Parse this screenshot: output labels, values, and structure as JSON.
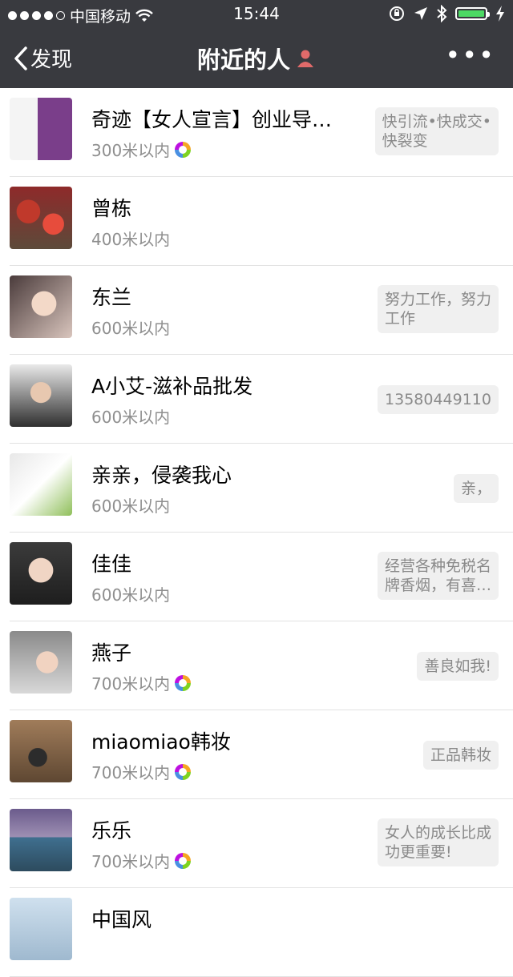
{
  "status_bar": {
    "carrier": "中国移动",
    "time": "15:44"
  },
  "nav": {
    "back_label": "发现",
    "title": "附近的人",
    "more_label": "•••"
  },
  "people": [
    {
      "name": "奇迹【女人宣言】创业导…",
      "distance": "300米以内",
      "has_moments_icon": true,
      "signature": "快引流•快成交•快裂变",
      "sig_lines": [
        "快引流•快成交•",
        "快裂变"
      ]
    },
    {
      "name": "曾栋",
      "distance": "400米以内",
      "has_moments_icon": false,
      "signature": "",
      "sig_lines": []
    },
    {
      "name": "东兰",
      "distance": "600米以内",
      "has_moments_icon": false,
      "signature": "努力工作，努力工作",
      "sig_lines": [
        "努力工作，努力",
        "工作"
      ]
    },
    {
      "name": "A小艾-滋补品批发",
      "distance": "600米以内",
      "has_moments_icon": false,
      "signature": "13580449110",
      "sig_lines": [
        "13580449110"
      ]
    },
    {
      "name": "亲亲，侵袭我心",
      "distance": "600米以内",
      "has_moments_icon": false,
      "signature": "亲，",
      "sig_lines": [
        "亲，"
      ]
    },
    {
      "name": "佳佳",
      "distance": "600米以内",
      "has_moments_icon": false,
      "signature": "经营各种免税名牌香烟，有喜…",
      "sig_lines": [
        "经营各种免税名",
        "牌香烟，有喜…"
      ]
    },
    {
      "name": "燕子",
      "distance": "700米以内",
      "has_moments_icon": true,
      "signature": "善良如我!",
      "sig_lines": [
        "善良如我!"
      ]
    },
    {
      "name": "miaomiao韩妆",
      "distance": "700米以内",
      "has_moments_icon": true,
      "signature": "正品韩妆",
      "sig_lines": [
        "正品韩妆"
      ]
    },
    {
      "name": "乐乐",
      "distance": "700米以内",
      "has_moments_icon": true,
      "signature": "女人的成长比成功更重要!",
      "sig_lines": [
        "女人的成长比成",
        "功更重要!"
      ]
    },
    {
      "name": "中国风",
      "distance": "",
      "has_moments_icon": false,
      "signature": "",
      "sig_lines": []
    }
  ],
  "colors": {
    "header_bg": "#393a3f",
    "battery": "#4cd964",
    "distance_text": "#8e8e8e",
    "signature_bg": "#f0f0f0"
  }
}
